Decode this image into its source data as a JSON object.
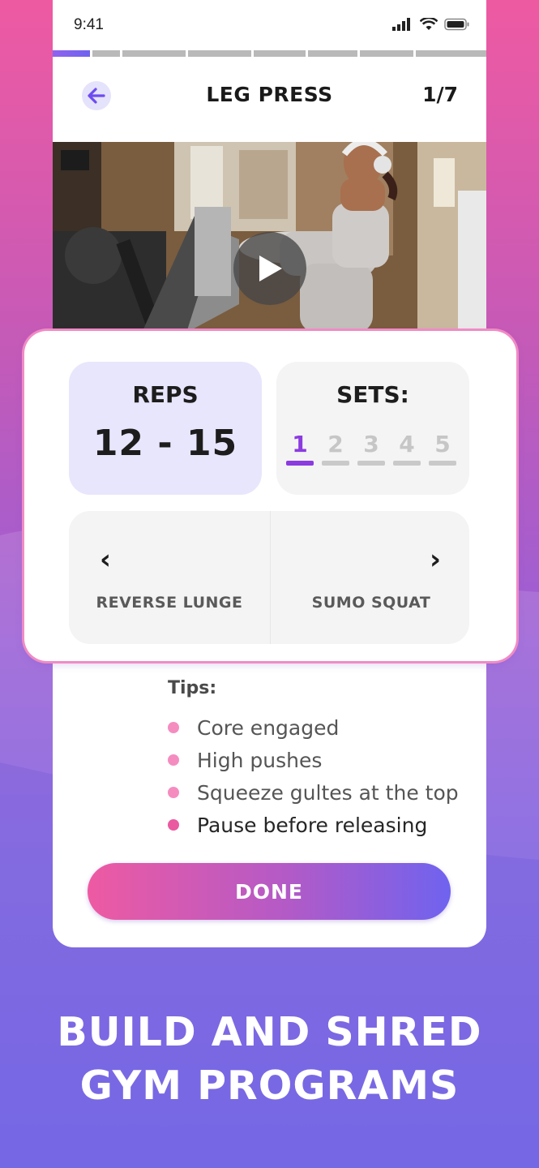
{
  "status_bar": {
    "time": "9:41"
  },
  "workout": {
    "progress": {
      "total_segments": 8,
      "current_segment": 1
    },
    "title": "LEG PRESS",
    "counter": "1/7"
  },
  "video": {
    "play_icon": "play-icon"
  },
  "reps": {
    "label": "REPS",
    "value": "12 - 15"
  },
  "sets": {
    "label": "SETS:",
    "items": [
      "1",
      "2",
      "3",
      "4",
      "5"
    ],
    "active_index": 0
  },
  "navigation": {
    "previous_label": "REVERSE LUNGE",
    "next_label": "SUMO SQUAT"
  },
  "tips": {
    "title": "Tips:",
    "items": [
      "Core engaged",
      "High pushes",
      "Squeeze gultes at the top",
      "Pause before releasing"
    ]
  },
  "done_label": "DONE",
  "headline": {
    "line1": "BUILD AND SHRED",
    "line2": "GYM PROGRAMS"
  },
  "colors": {
    "accent_pink": "#ee5aa2",
    "accent_purple": "#8b3be0",
    "accent_blue": "#6f63ef",
    "reps_bg": "#e8e6fc"
  }
}
